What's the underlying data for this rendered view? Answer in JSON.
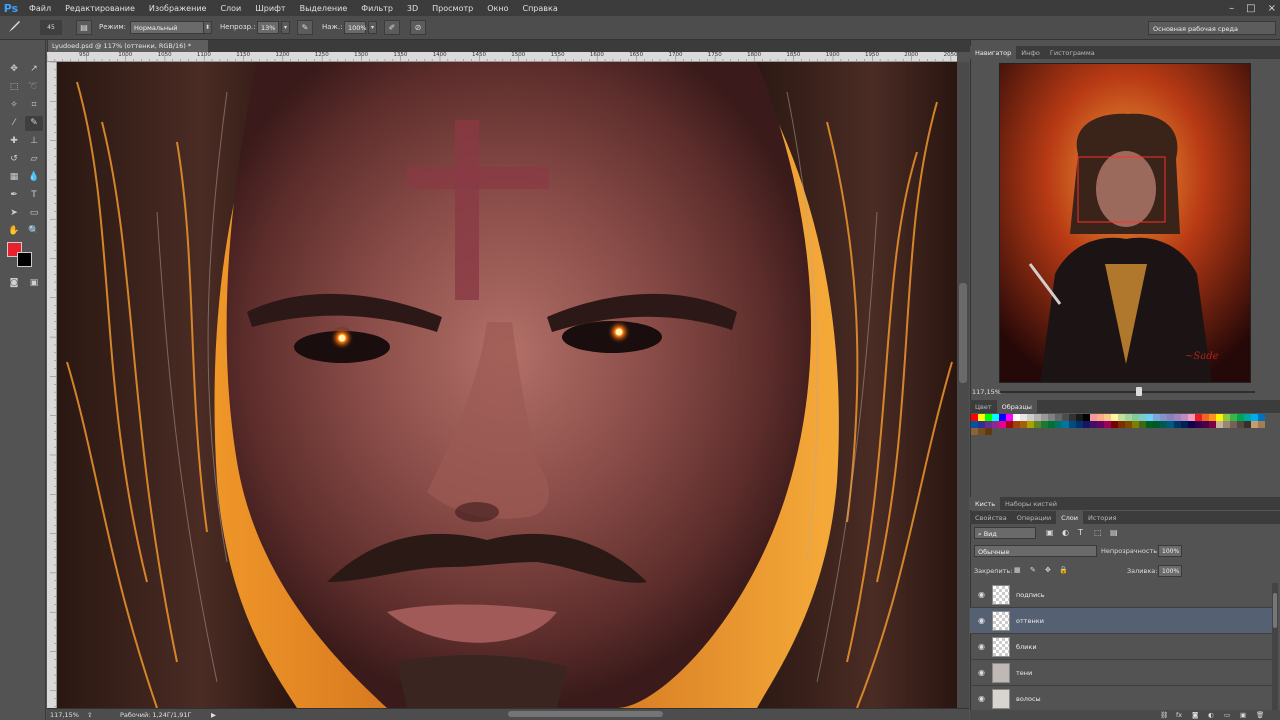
{
  "app": {
    "logo": "Ps"
  },
  "menu": [
    "Файл",
    "Редактирование",
    "Изображение",
    "Слои",
    "Шрифт",
    "Выделение",
    "Фильтр",
    "3D",
    "Просмотр",
    "Окно",
    "Справка"
  ],
  "window_controls": {
    "minimize": "–",
    "maximize": "□",
    "close": "×"
  },
  "options": {
    "brush_size": "45",
    "mode_label": "Режим:",
    "mode_value": "Нормальный",
    "opacity_label": "Непрозр.:",
    "opacity_value": "13%",
    "pressure_label": "Наж.:",
    "pressure_value": "100%",
    "workspace": "Основная рабочая среда"
  },
  "document": {
    "tab_title": "Lyudoed.psd @ 117% (оттенки, RGB/16) *",
    "ruler_ticks": [
      "950",
      "1000",
      "1050",
      "1100",
      "1150",
      "1200",
      "1250",
      "1300",
      "1350",
      "1400",
      "1450",
      "1500",
      "1550",
      "1600",
      "1650",
      "1700",
      "1750",
      "1800",
      "1850",
      "1900",
      "1950",
      "2000",
      "2050"
    ]
  },
  "status": {
    "zoom": "117,15%",
    "doc_info": "Рабочий: 1,24Г/1,91Г"
  },
  "panels": {
    "top_tabs": [
      "Навигатор",
      "Инфо",
      "Гистограмма"
    ],
    "navigator_zoom": "117,15%",
    "color_tabs": [
      "Цвет",
      "Образцы"
    ],
    "brush_tabs": [
      "Кисть",
      "Наборы кистей"
    ],
    "layer_tabs": [
      "Свойства",
      "Операции",
      "Слои",
      "История"
    ]
  },
  "layers": {
    "filter_kind": "Вид",
    "blend_mode": "Обычные",
    "opacity_label": "Непрозрачность:",
    "opacity_value": "100%",
    "lock_label": "Закрепить:",
    "fill_label": "Заливка:",
    "fill_value": "100%",
    "items": [
      {
        "name": "подпись",
        "selected": false
      },
      {
        "name": "оттенки",
        "selected": true
      },
      {
        "name": "блики",
        "selected": false
      },
      {
        "name": "тени",
        "selected": false
      },
      {
        "name": "волосы",
        "selected": false
      }
    ]
  },
  "colors": {
    "foreground": "#e8222c",
    "background": "#000000",
    "selection": "#556073"
  }
}
